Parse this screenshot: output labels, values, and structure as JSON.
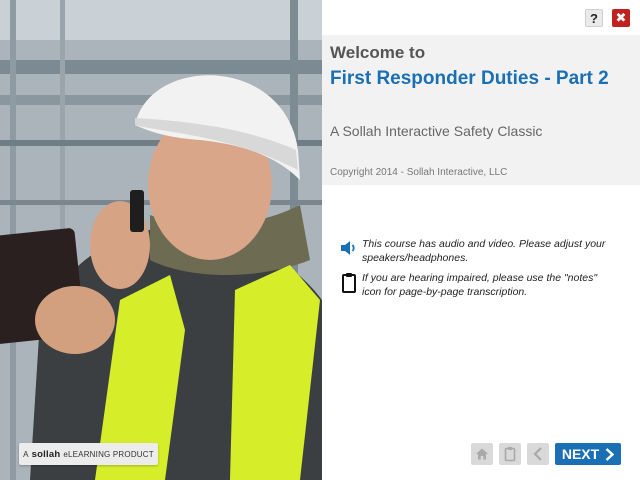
{
  "header": {
    "help_label": "?",
    "close_label": "✖"
  },
  "title_block": {
    "welcome": "Welcome to",
    "course_title": "First Responder Duties - Part 2",
    "subtitle": "A Sollah Interactive Safety Classic",
    "copyright": "Copyright 2014 - Sollah Interactive, LLC"
  },
  "notices": [
    {
      "icon": "speaker-icon",
      "text": "This course has audio and video. Please adjust your speakers/headphones."
    },
    {
      "icon": "notes-icon",
      "text": "If you are hearing impaired, please use the \"notes\" icon for page-by-page transcription."
    }
  ],
  "badge": {
    "prefix": "A",
    "brand": "sollah",
    "suffix": "eLEARNING PRODUCT"
  },
  "nav": {
    "next_label": "NEXT",
    "home_icon": "home-icon",
    "notes_icon": "notes-icon",
    "back_icon": "back-arrow-icon"
  },
  "colors": {
    "accent": "#1a6fb5",
    "close": "#c0201e",
    "nav_disabled": "#d9d9d9"
  }
}
